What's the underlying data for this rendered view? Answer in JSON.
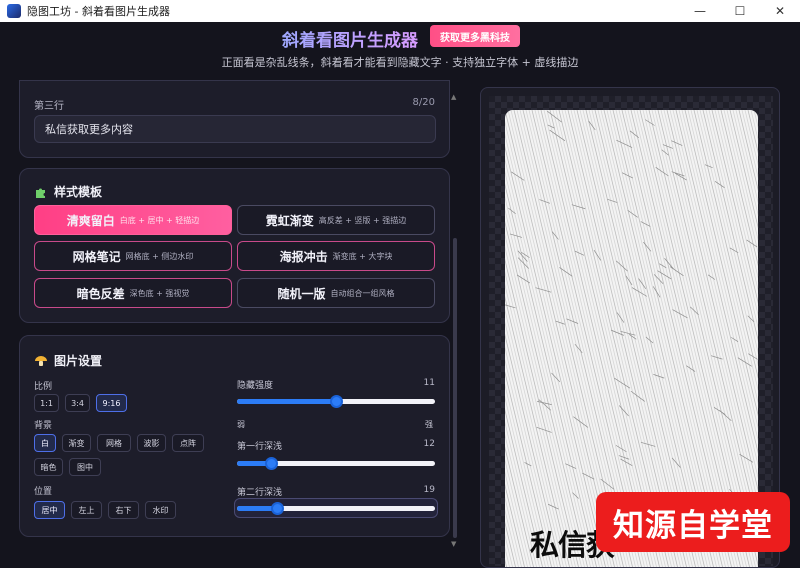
{
  "window": {
    "title": "隐图工坊 - 斜着看图片生成器",
    "minimize": "—",
    "maximize": "☐",
    "close": "✕"
  },
  "header": {
    "title": "斜着看图片生成器",
    "more_button": "获取更多黑科技",
    "subtitle": "正面看是杂乱线条，斜着看才能看到隐藏文字 · 支持独立字体 + 虚线描边"
  },
  "text_rows": {
    "label": "第三行",
    "count": "8/20",
    "value": "私信获取更多内容"
  },
  "style_templates": {
    "heading": "样式模板",
    "icon": "puzzle-icon",
    "items": [
      {
        "name": "清爽留白",
        "desc": "白底 + 居中 + 轻描边"
      },
      {
        "name": "霓虹渐变",
        "desc": "高反差 + 竖版 + 强描边"
      },
      {
        "name": "网格笔记",
        "desc": "网格底 + 侧边水印"
      },
      {
        "name": "海报冲击",
        "desc": "渐变底 + 大字块"
      },
      {
        "name": "暗色反差",
        "desc": "深色底 + 强视觉"
      },
      {
        "name": "随机一版",
        "desc": "自动组合一组风格"
      }
    ],
    "active_index": 0
  },
  "image_settings": {
    "heading": "图片设置",
    "icon": "mushroom-icon",
    "ratio": {
      "label": "比例",
      "options": [
        "1:1",
        "3:4",
        "9:16"
      ],
      "selected": "9:16"
    },
    "background": {
      "label": "背景",
      "options": [
        "白",
        "渐变",
        "网格",
        "波影",
        "点阵",
        "暗色",
        "图中"
      ],
      "selected": "白"
    },
    "position": {
      "label": "位置",
      "options": [
        "居中",
        "左上",
        "右下",
        "水印"
      ],
      "selected": "居中"
    },
    "sliders": [
      {
        "label": "隐藏强度",
        "value": "11",
        "level": 0.5
      },
      {
        "label": "第一行深浅",
        "value": "12",
        "level": 0.17
      },
      {
        "label": "第二行深浅",
        "value": "19",
        "level": 0.2
      }
    ],
    "hint_left": "弱",
    "hint_right": "强"
  },
  "preview": {
    "visible_text": "私信获",
    "watermark": "知源自学堂"
  },
  "colors": {
    "accent_pink": "#ff4f8a",
    "accent_blue": "#2c7cf6",
    "panel_bg": "#1d1d2a",
    "page_bg": "#14141d",
    "watermark_red": "#ec1d1d"
  }
}
